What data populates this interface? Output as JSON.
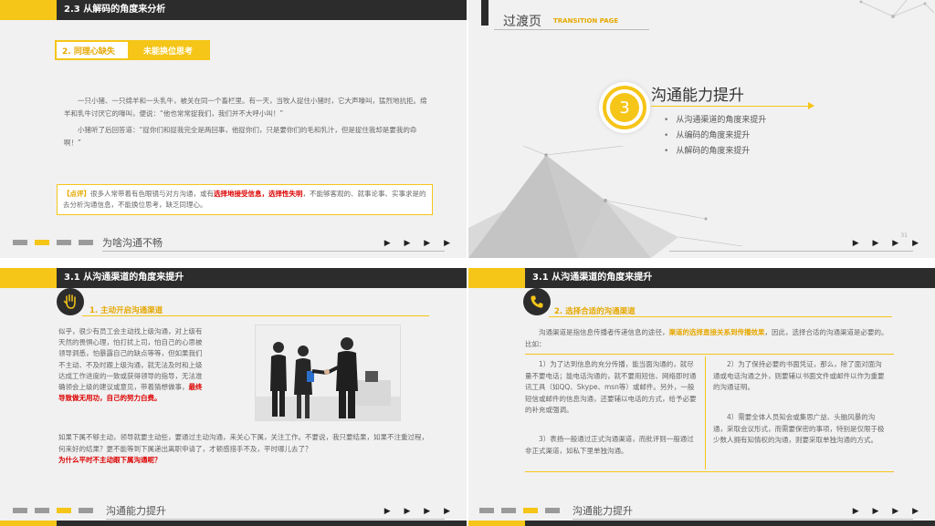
{
  "colors": {
    "accent": "#f5c518",
    "dark": "#2c2c2c",
    "highlight_red": "#dd0000"
  },
  "slide1": {
    "header": "2.3 从解码的角度来分析",
    "tag_left": "2. 同理心缺失",
    "tag_right": "未能换位思考",
    "story_p1": "一只小猪、一只绵羊和一头乳牛，被关在同一个畜栏里。有一天，当牧人捉住小猪时，它大声嚎叫，猛烈地抗拒。绵羊和乳牛讨厌它的嚎叫，便说：“他也常常捉我们，我们并不大呼小叫！”",
    "story_p2": "小猪听了后回答道：“捉你们和捉我完全是两回事，他捉你们，只是要你们的毛和乳汁，但是捉住我却是要我的命啊！”",
    "note_label": "【点评】",
    "note_text1": "很多人常带着有色眼镜与对方沟通，或有",
    "note_red": "选择地接受信息，选择性失明",
    "note_text2": "，不能够客观的、就事论事、实事求是的去分析沟通信息，不能换位思考，缺乏同理心。",
    "footer": "为啥沟通不畅",
    "arrows": "▶ ▶ ▶ ▶"
  },
  "slide2": {
    "title": "过渡页",
    "subtitle": "TRANSITION PAGE",
    "number": "3",
    "main": "沟通能力提升",
    "items": [
      "从沟通渠道的角度来提升",
      "从编码的角度来提升",
      "从解码的角度来提升"
    ],
    "page_no": "31",
    "arrows": "▶ ▶ ▶ ▶"
  },
  "slide3": {
    "header": "3.1 从沟通渠道的角度来提升",
    "section": "1. 主动开启沟通渠道",
    "icon": "hand-icon",
    "left_text": "似乎，很少有员工会主动找上级沟通，对上级有天然的畏惧心理，怕打扰上司，怕自己的心思被领导洞悉，怕暴露自己的缺点等等，但如果我们不主动、不及时跟上级沟通，就无法及时和上级达成工作进度的一致或获得领导的指导，无法准确领会上级的建议或意见，带着猜想做事，",
    "left_red": "最终导致做无用功，自己的努力白费。",
    "bottom_text": "如果下属不够主动，领导就要主动些，要通过主动沟通，来关心下属，关注工作。不要说，我只要结果，如果不注重过程，何来好的结果？更不能等到下属递出离职申请了，才顿感措手不及，平时哪儿去了？",
    "bottom_red": "为什么平时不主动跟下属沟通呢？",
    "footer": "沟通能力提升",
    "arrows": "▶ ▶ ▶ ▶"
  },
  "slide4": {
    "header": "3.1 从沟通渠道的角度来提升",
    "section": "2. 选择合适的沟通渠道",
    "icon": "phone-icon",
    "intro1": "沟通渠道是指信息传播者传递信息的途径，",
    "intro_hl": "渠道的选择直接关系到传播效果",
    "intro2": "，因此，选择合适的沟通渠道是必要的。比如：",
    "p1": "1）为了达到信息的充分传播，能当面沟通的，就尽量不要电话；能电话沟通的，就不要用短信、网络即时通讯工具（如QQ、Skype、msn等）或邮件。另外，一般短信或邮件的信息沟通，还要辅以电话的方式，给予必要的补充或强调。",
    "p3": "3）表扬一般通过正式沟通渠道，而批评则一般通过非正式渠道，如私下里单独沟通。",
    "p2": "2）为了保持必要的书面凭证，那么，除了面对面沟通或电话沟通之外，则要辅以书面文件或邮件以作为重要的沟通证明。",
    "p4": "4）需要全体人员知会或集思广益、头脑风暴的沟通，采取会议形式，而需要保密的事项，特别是仅限于极少数人拥有知情权的沟通，则要采取单独沟通的方式。",
    "footer": "沟通能力提升",
    "arrows": "▶ ▶ ▶ ▶"
  }
}
